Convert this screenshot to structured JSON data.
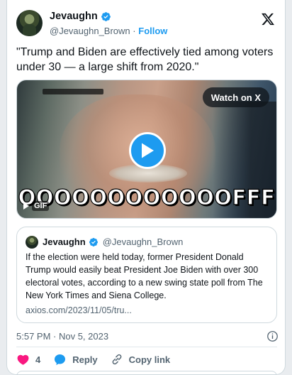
{
  "author": {
    "name": "Jevaughn",
    "handle": "@Jevaughn_Brown",
    "separator": "·",
    "follow_label": "Follow"
  },
  "tweet": {
    "text": "\"Trump and Biden are effectively tied among voters under 30 — a large shift from 2020.\""
  },
  "media": {
    "watch_label": "Watch on X",
    "caption": "OOOOOOOOOOOOFFF",
    "gif_label": "GIF"
  },
  "quote": {
    "name": "Jevaughn",
    "handle": "@Jevaughn_Brown",
    "text": "If the election were held today, former President Donald Trump would easily beat President Joe Biden with over 300 electoral votes, according to a new swing state poll from The New York Times and Siena College.",
    "link": "axios.com/2023/11/05/tru..."
  },
  "meta": {
    "timestamp": "5:57 PM · Nov 5, 2023"
  },
  "actions": {
    "like_count": "4",
    "reply_label": "Reply",
    "copy_label": "Copy link"
  },
  "colors": {
    "accent": "#1d9bf0",
    "like": "#f91880",
    "secondary_text": "#536471"
  },
  "icons": [
    "verified-badge-icon",
    "x-logo-icon",
    "play-icon",
    "gif-icon",
    "info-icon",
    "heart-icon",
    "reply-icon",
    "link-icon"
  ]
}
